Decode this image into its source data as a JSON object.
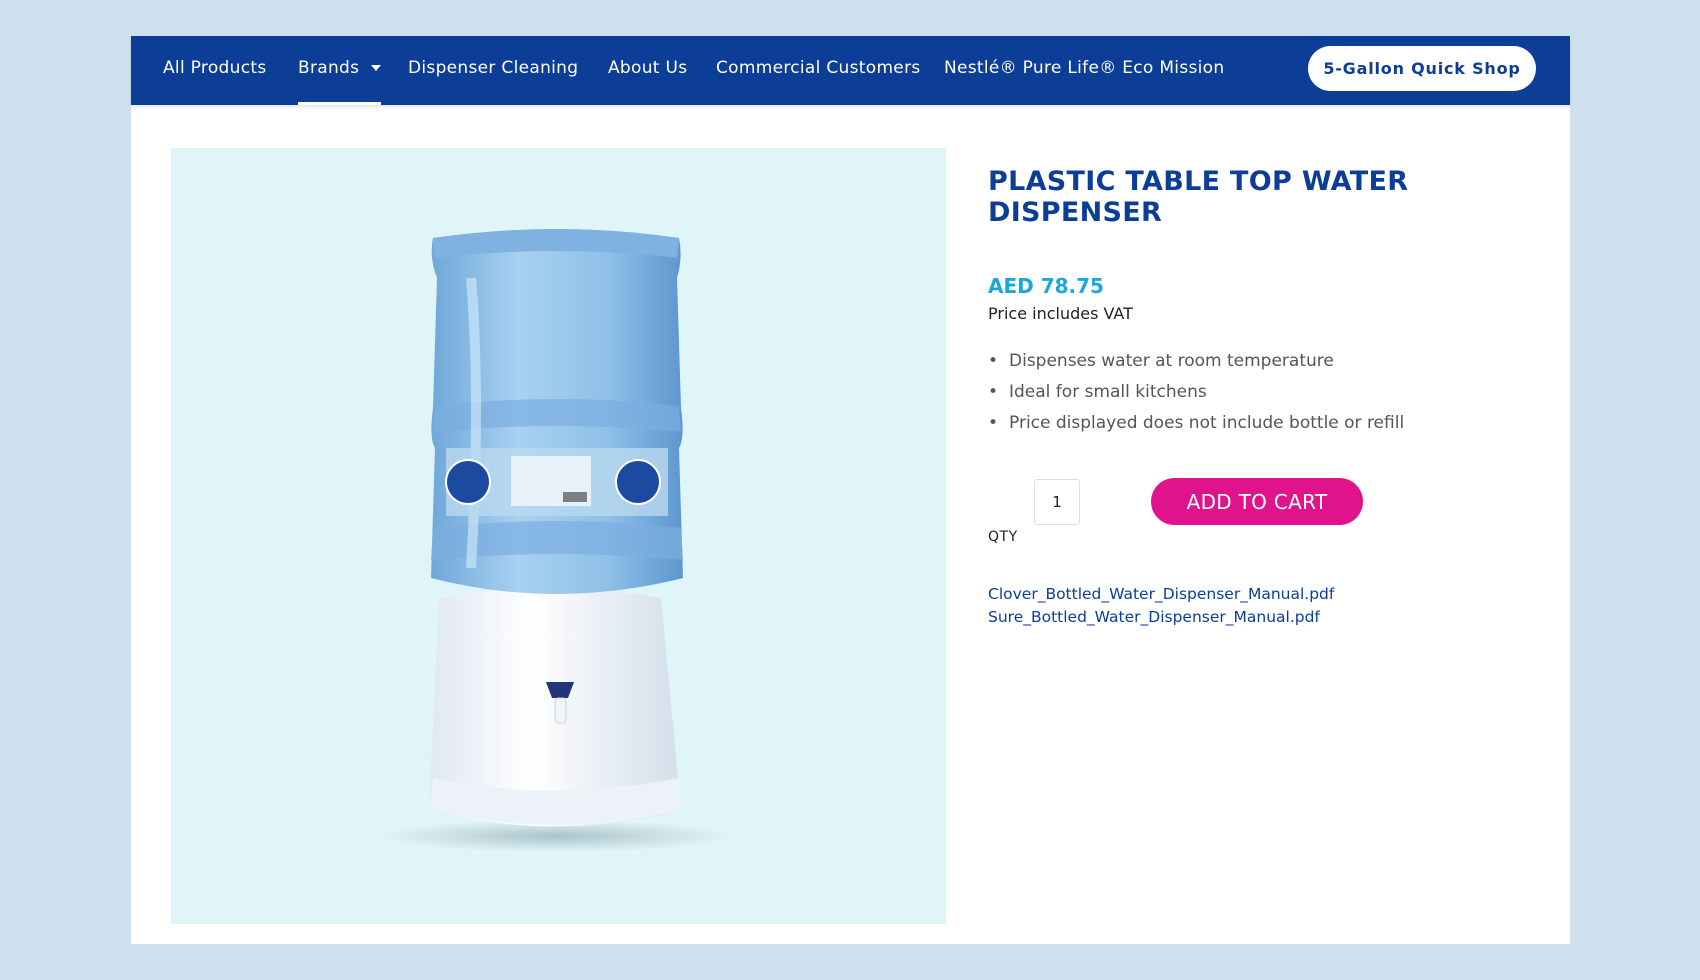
{
  "nav": {
    "items": [
      {
        "label": "All Products"
      },
      {
        "label": "Brands"
      },
      {
        "label": "Dispenser Cleaning"
      },
      {
        "label": "About Us"
      },
      {
        "label": "Commercial Customers"
      },
      {
        "label": "Nestlé® Pure Life® Eco Mission"
      }
    ],
    "active": "Brands",
    "quick_shop_label": "5-Gallon Quick Shop"
  },
  "product": {
    "title": "PLASTIC TABLE TOP WATER DISPENSER",
    "price": "AED 78.75",
    "vat_note": "Price includes VAT",
    "features": [
      "Dispenses water at room temperature",
      "Ideal for small kitchens",
      "Price displayed does not include bottle or refill"
    ],
    "qty_label": "QTY",
    "qty_value": "1",
    "add_to_cart_label": "ADD TO CART",
    "manuals": [
      "Clover_Bottled_Water_Dispenser_Manual.pdf",
      "Sure_Bottled_Water_Dispenser_Manual.pdf"
    ],
    "image_icon": "water-dispenser-image"
  },
  "colors": {
    "nav_bg": "#0d3e97",
    "page_bg": "#cfe0ee",
    "title": "#0d3e97",
    "price": "#1aa8dc",
    "cart_button": "#e0138c",
    "image_bg": "#e0f5f8"
  }
}
